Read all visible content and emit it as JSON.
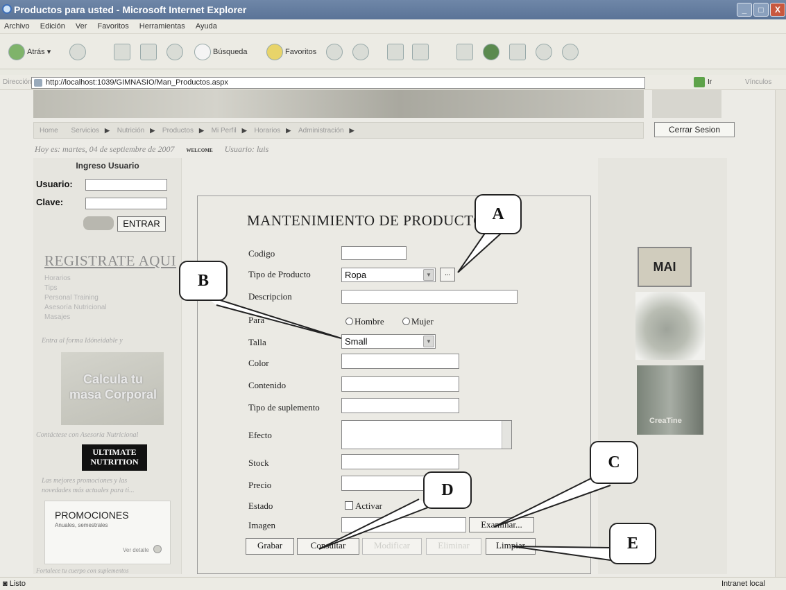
{
  "window": {
    "title": "Productos para usted - Microsoft Internet Explorer",
    "controls": [
      "_",
      "□",
      "X"
    ]
  },
  "menu": [
    "Archivo",
    "Edición",
    "Ver",
    "Favoritos",
    "Herramientas",
    "Ayuda"
  ],
  "toolbar": {
    "back_label": "Atrás",
    "search_label": "Búsqueda",
    "favorites_label": "Favoritos"
  },
  "address": {
    "label": "Dirección",
    "url": "http://localhost:1039/GIMNASIO/Man_Productos.aspx",
    "go_label": "Ir",
    "links_label": "Vínculos"
  },
  "nav": {
    "items": [
      "Home",
      "Servicios",
      "Nutrición",
      "Productos",
      "Mi Perfil",
      "Horarios",
      "Administración"
    ],
    "logout_label": "Cerrar Sesion"
  },
  "dateline": {
    "date_text": "Hoy es: martes, 04 de septiembre de 2007",
    "welcome": "WELCOME",
    "user_text": "Usuario: luis"
  },
  "login": {
    "title": "Ingreso Usuario",
    "user_label": "Usuario:",
    "password_label": "Clave:",
    "enter_label": "ENTRAR"
  },
  "sidebar": {
    "register": "REGISTRATE AQUI",
    "links": [
      "Horarios",
      "Tips",
      "Personal Training",
      "Asesoría Nutricional",
      "Masajes"
    ],
    "note1": "Entra al forma Idóneidable y",
    "calc_text": "Calcula tu masa Corporal",
    "note2": "Contáctese con Asesoría Nutricional",
    "logo_text": "ULTIMATE NUTRITION",
    "note3": "Las mejores promociones y las",
    "note3b": "novedades más actuales para ti...",
    "promo_title": "PROMOCIONES",
    "promo_sub": "Anuales, semestrales",
    "promo_link": "Ver detalle",
    "footer_note": "Fortalece tu cuerpo con suplementos"
  },
  "rightcol": {
    "mai_text": "MAI",
    "bottle_text": "CreaTine"
  },
  "form": {
    "title": "MANTENIMIENTO DE PRODUCTOS",
    "labels": {
      "codigo": "Codigo",
      "tipo": "Tipo de Producto",
      "descripcion": "Descripcion",
      "para": "Para",
      "talla": "Talla",
      "color": "Color",
      "contenido": "Contenido",
      "tipo_suplemento": "Tipo de suplemento",
      "efecto": "Efecto",
      "stock": "Stock",
      "precio": "Precio",
      "estado": "Estado",
      "imagen": "Imagen"
    },
    "tipo_value": "Ropa",
    "tipo_browse": "...",
    "para_options": [
      "Hombre",
      "Mujer"
    ],
    "talla_value": "Small",
    "estado_check": "Activar",
    "browse_label": "Examinar...",
    "buttons": {
      "grabar": "Grabar",
      "consultar": "Consultar",
      "modificar": "Modificar",
      "eliminar": "Eliminar",
      "limpiar": "Limpiar"
    }
  },
  "callouts": [
    "A",
    "B",
    "C",
    "D",
    "E"
  ],
  "status": {
    "left": "Listo",
    "right": "Intranet local"
  }
}
